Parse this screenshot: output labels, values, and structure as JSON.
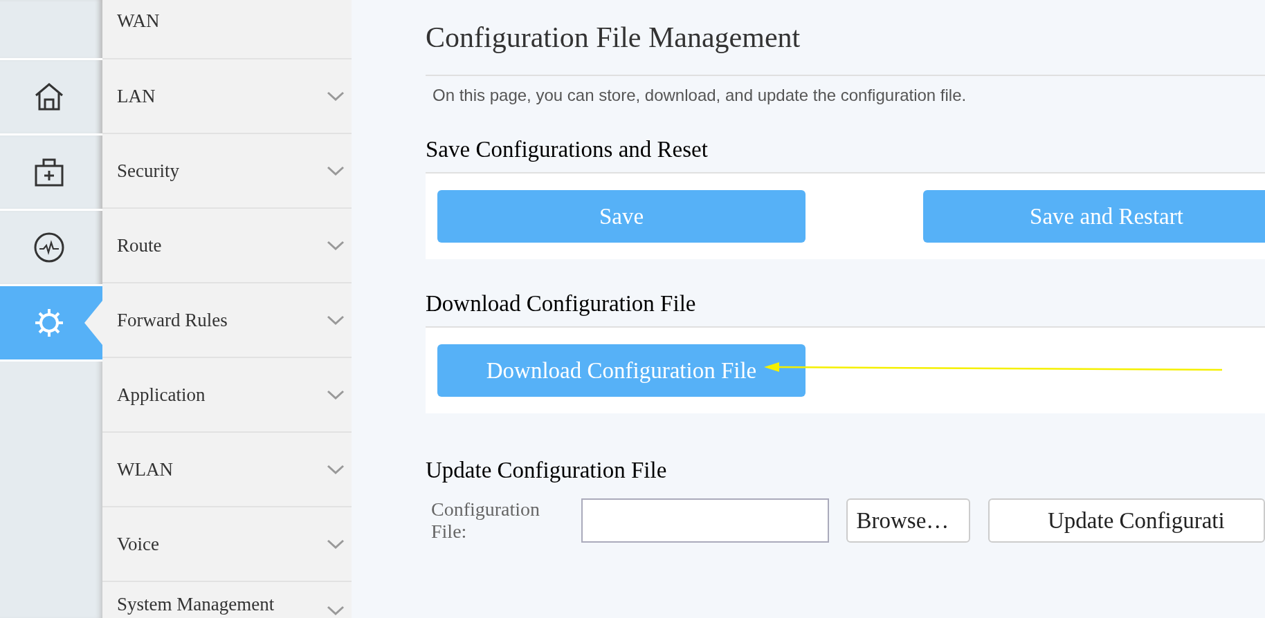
{
  "nav_icons": [
    {
      "kind": "blank",
      "selected": false
    },
    {
      "kind": "home",
      "selected": false
    },
    {
      "kind": "toolbox",
      "selected": false
    },
    {
      "kind": "pulse",
      "selected": false
    },
    {
      "kind": "gear",
      "selected": true
    }
  ],
  "menu": [
    {
      "label": "WAN",
      "expandable": false
    },
    {
      "label": "LAN",
      "expandable": true
    },
    {
      "label": "Security",
      "expandable": true
    },
    {
      "label": "Route",
      "expandable": true
    },
    {
      "label": "Forward Rules",
      "expandable": true
    },
    {
      "label": "Application",
      "expandable": true
    },
    {
      "label": "WLAN",
      "expandable": true
    },
    {
      "label": "Voice",
      "expandable": true
    },
    {
      "label": "System Management",
      "expandable": true
    }
  ],
  "page": {
    "title": "Configuration File Management",
    "description": "On this page, you can store, download, and update the configuration file."
  },
  "sections": [
    {
      "kind": "buttons",
      "heading": "Save Configurations and Reset",
      "buttons": [
        "Save",
        "Save and Restart"
      ]
    },
    {
      "kind": "buttons",
      "heading": "Download Configuration File",
      "buttons": [
        "Download Configuration File"
      ],
      "annotation_arrow": true
    },
    {
      "kind": "upload",
      "heading": "Update Configuration File",
      "label": "Configuration File:",
      "browse": "Browse…",
      "button": "Update Configurati"
    }
  ]
}
